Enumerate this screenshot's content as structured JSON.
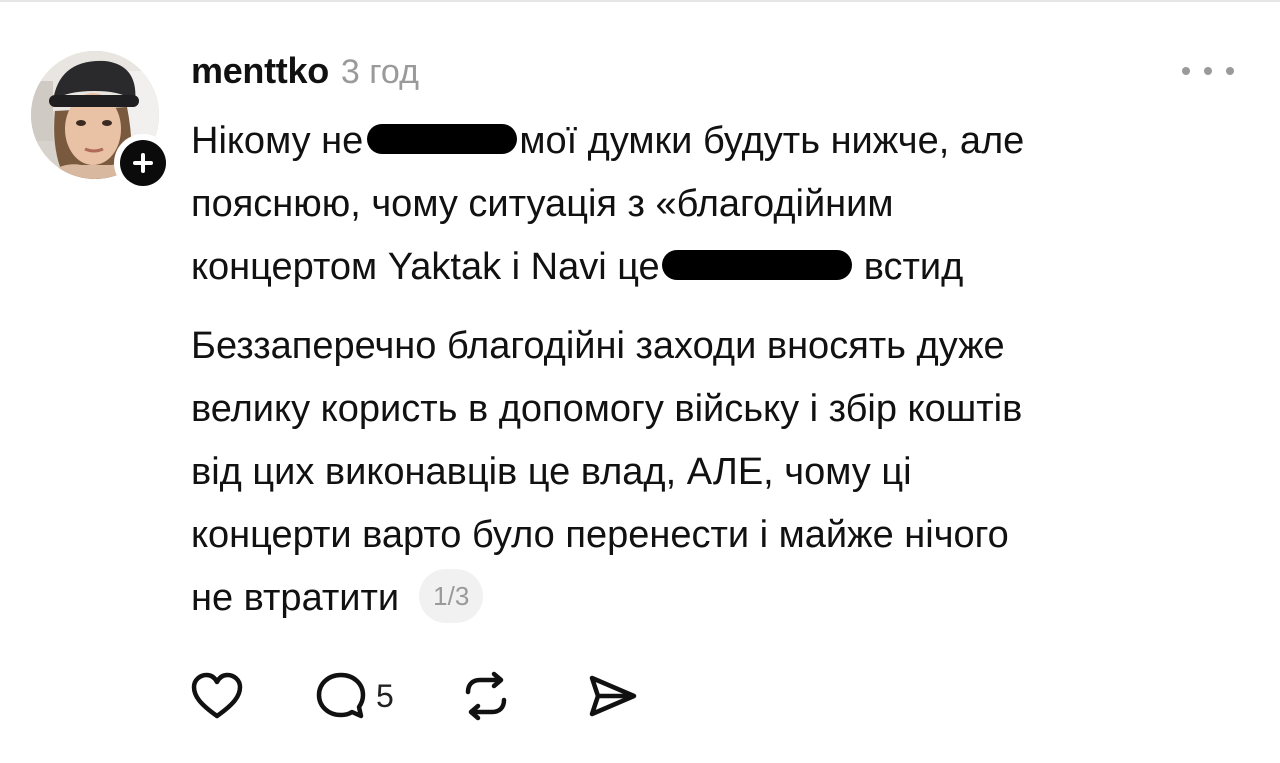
{
  "post": {
    "author": {
      "username": "menttko",
      "avatar_icon": "profile-photo",
      "follow_icon": "plus-icon"
    },
    "timestamp": "3 год",
    "more_icon": "ellipsis-icon",
    "paragraph1": {
      "line1_before": "Нікому не",
      "line1_after": "мої думки будуть нижче, але",
      "line2": "пояснюю, чому ситуація з «благодійним",
      "line3_before": "концертом Yaktak і Navi це",
      "line3_after": "встид"
    },
    "paragraph2": {
      "line1": "Беззаперечно благодійні заходи вносять дуже",
      "line2": "велику користь в допомогу війську і збір коштів",
      "line3": "від цих виконавців це влад, АЛЕ, чому ці",
      "line4": "концерти варто було перенести і майже нічого",
      "line5": "не втратити"
    },
    "page_indicator": "1/3",
    "actions": {
      "like_icon": "heart-icon",
      "comment_icon": "comment-bubble-icon",
      "comment_count": "5",
      "repost_icon": "repost-arrows-icon",
      "share_icon": "send-paper-plane-icon"
    }
  }
}
